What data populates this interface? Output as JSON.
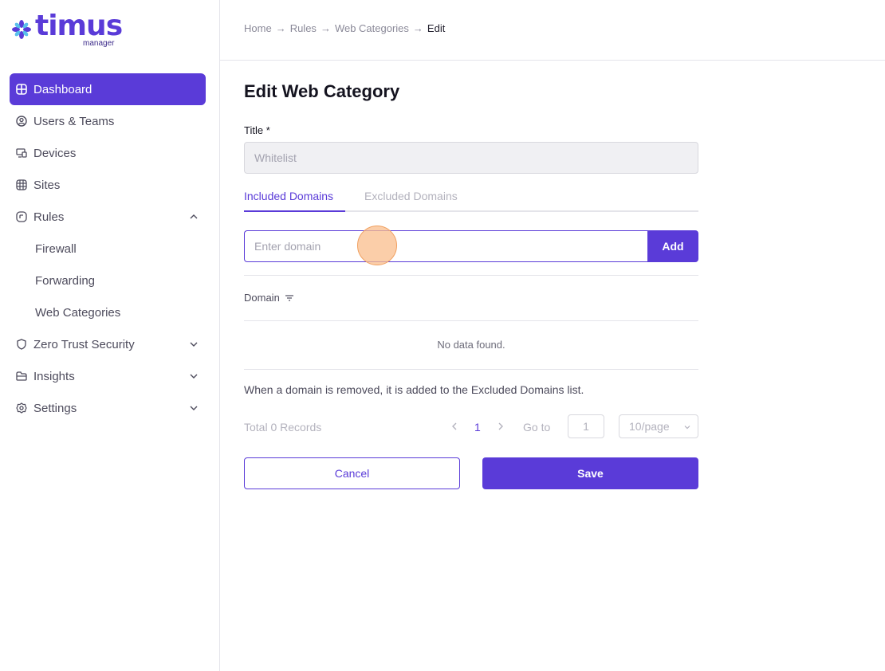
{
  "brand": {
    "name": "timus",
    "sub": "manager",
    "accent": "#5a3bd8"
  },
  "sidebar": {
    "items": [
      {
        "label": "Dashboard",
        "icon": "dashboard-icon",
        "active": true
      },
      {
        "label": "Users & Teams",
        "icon": "user-circle-icon"
      },
      {
        "label": "Devices",
        "icon": "devices-icon"
      },
      {
        "label": "Sites",
        "icon": "sites-icon"
      },
      {
        "label": "Rules",
        "icon": "rules-icon",
        "expanded": true
      },
      {
        "label": "Firewall"
      },
      {
        "label": "Forwarding"
      },
      {
        "label": "Web Categories"
      },
      {
        "label": "Zero Trust Security",
        "icon": "shield-icon"
      },
      {
        "label": "Insights",
        "icon": "insights-icon"
      },
      {
        "label": "Settings",
        "icon": "gear-icon"
      }
    ]
  },
  "breadcrumb": [
    "Home",
    "Rules",
    "Web Categories",
    "Edit"
  ],
  "page": {
    "title": "Edit Web Category"
  },
  "form": {
    "title_label": "Title *",
    "title_value": "Whitelist",
    "tabs": [
      "Included Domains",
      "Excluded Domains"
    ],
    "domain_placeholder": "Enter domain",
    "add_label": "Add"
  },
  "table": {
    "column": "Domain",
    "empty": "No data found.",
    "note": "When a domain is removed, it is added to the Excluded Domains list."
  },
  "pagination": {
    "total": "Total 0 Records",
    "current_page": "1",
    "goto_label": "Go to",
    "goto_value": "1",
    "per_page": "10/page"
  },
  "actions": {
    "cancel": "Cancel",
    "save": "Save"
  }
}
